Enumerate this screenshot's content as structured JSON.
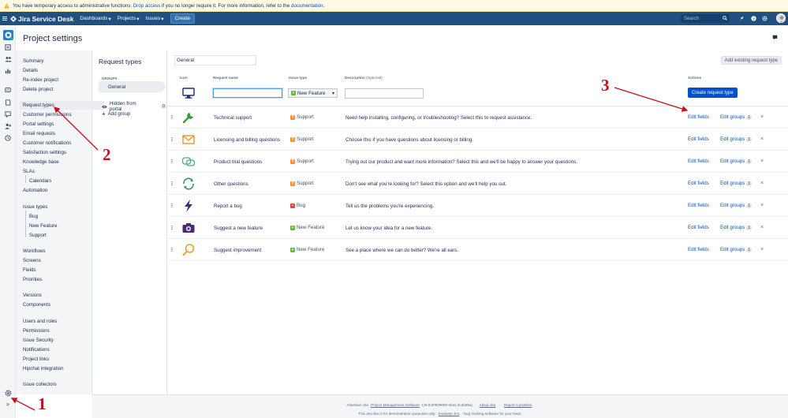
{
  "banner": {
    "text_before": "You have temporary access to administrative functions.",
    "drop_access": "Drop access",
    "text_middle": "if you no longer require it. For more information, refer to the",
    "documentation": "documentation."
  },
  "topnav": {
    "logo": "Jira Service Desk",
    "items": [
      "Dashboards",
      "Projects",
      "Issues"
    ],
    "create": "Create",
    "search_placeholder": "Search"
  },
  "page": {
    "title": "Project settings"
  },
  "sidebar": {
    "summary": "Summary",
    "details": "Details",
    "reindex": "Re-index project",
    "delete": "Delete project",
    "request_types": "Request types",
    "customer_permissions": "Customer permissions",
    "portal_settings": "Portal settings",
    "email_requests": "Email requests",
    "customer_notifications": "Customer notifications",
    "satisfaction_settings": "Satisfaction settings",
    "knowledge_base": "Knowledge base",
    "slas": "SLAs",
    "calendars": "Calendars",
    "automation": "Automation",
    "issue_types": "Issue types",
    "bug": "Bug",
    "new_feature": "New Feature",
    "support": "Support",
    "workflows": "Workflows",
    "screens": "Screens",
    "fields": "Fields",
    "priorities": "Priorities",
    "versions": "Versions",
    "components": "Components",
    "users_roles": "Users and roles",
    "permissions": "Permissions",
    "issue_security": "Issue Security",
    "notifications": "Notifications",
    "project_links": "Project links",
    "hipchat": "Hipchat integration",
    "issue_collectors": "Issue collectors"
  },
  "groups": {
    "title": "Request types",
    "label": "GROUPS",
    "general": "General",
    "hidden": "Hidden from portal",
    "hidden_count": "0",
    "add_group": "Add group"
  },
  "main": {
    "group_name_value": "General",
    "add_existing": "Add existing request type",
    "headers": {
      "icon": "Icon",
      "name": "Request name",
      "type": "Issue type",
      "desc": "Description",
      "desc_opt": "(Optional)",
      "actions": "Actions"
    },
    "new_type_default": "New Feature",
    "create_button": "Create request type",
    "edit_fields": "Edit fields",
    "edit_groups": "Edit groups",
    "rows": [
      {
        "name": "Technical support",
        "type": "Support",
        "desc": "Need help installing, configuring, or troubleshooting? Select this to request assistance.",
        "count": "1"
      },
      {
        "name": "Licensing and billing questions",
        "type": "Support",
        "desc": "Choose this if you have questions about licensing or billing.",
        "count": "1"
      },
      {
        "name": "Product trial questions",
        "type": "Support",
        "desc": "Trying out our product and want more information? Select this and we'll be happy to answer your questions.",
        "count": "1"
      },
      {
        "name": "Other questions",
        "type": "Support",
        "desc": "Don't see what you're looking for? Select this option and we'll help you out.",
        "count": "1"
      },
      {
        "name": "Report a bug",
        "type": "Bug",
        "desc": "Tell us the problems you're experiencing.",
        "count": "1"
      },
      {
        "name": "Suggest a new feature",
        "type": "New Feature",
        "desc": "Let us know your idea for a new feature.",
        "count": "1"
      },
      {
        "name": "Suggest improvement",
        "type": "New Feature",
        "desc": "See a place where we can do better? We're all ears.",
        "count": "1"
      }
    ]
  },
  "footer": {
    "l1_a": "Atlassian Jira",
    "l1_link": "Project Management Software",
    "l1_version": "(v8.9.0#809000-sha1:4cab90a)",
    "about": "About Jira",
    "report": "Report a problem",
    "l2_a": "This Jira site is for demonstration purposes only.",
    "evaluate": "Evaluate Jira",
    "l2_b": "- bug tracking software for your team."
  },
  "annotations": [
    "1",
    "2",
    "3"
  ],
  "colors": {
    "topnav": "#205081",
    "primary": "#0052cc",
    "annotation": "#c1121f",
    "support": "#f79232",
    "bug": "#e5493a",
    "feature": "#63ba3c"
  }
}
